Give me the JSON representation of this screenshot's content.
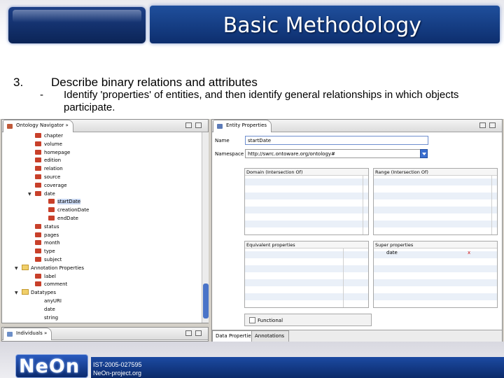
{
  "slide": {
    "title": "Basic Methodology",
    "bullet_number": "3.",
    "bullet_heading": "Describe binary relations and attributes",
    "sub_dash": "-",
    "sub_text": "Identify 'properties' of entities, and then identify general relationships in which objects participate."
  },
  "navigator": {
    "tab_label": "Ontology Navigator",
    "tab_suffix": "»",
    "tree": [
      {
        "label": "chapter",
        "icon": "property-icon",
        "indent": 1
      },
      {
        "label": "volume",
        "icon": "property-icon",
        "indent": 1
      },
      {
        "label": "homepage",
        "icon": "property-icon",
        "indent": 1
      },
      {
        "label": "edition",
        "icon": "property-icon",
        "indent": 1
      },
      {
        "label": "relation",
        "icon": "property-icon",
        "indent": 1
      },
      {
        "label": "source",
        "icon": "property-icon",
        "indent": 1
      },
      {
        "label": "coverage",
        "icon": "property-icon",
        "indent": 1
      },
      {
        "label": "date",
        "icon": "property-icon",
        "indent": 1,
        "twisty": "▼"
      },
      {
        "label": "startDate",
        "icon": "property-icon",
        "indent": 2,
        "selected": true
      },
      {
        "label": "creationDate",
        "icon": "property-icon",
        "indent": 2
      },
      {
        "label": "endDate",
        "icon": "property-icon",
        "indent": 2
      },
      {
        "label": "status",
        "icon": "property-icon",
        "indent": 1
      },
      {
        "label": "pages",
        "icon": "property-icon",
        "indent": 1
      },
      {
        "label": "month",
        "icon": "property-icon",
        "indent": 1
      },
      {
        "label": "type",
        "icon": "property-icon",
        "indent": 1
      },
      {
        "label": "subject",
        "icon": "property-icon",
        "indent": 1
      },
      {
        "label": "Annotation Properties",
        "icon": "folder-icon",
        "indent": 0,
        "twisty": "▼"
      },
      {
        "label": "label",
        "icon": "property-icon",
        "indent": 1
      },
      {
        "label": "comment",
        "icon": "property-icon",
        "indent": 1
      },
      {
        "label": "Datatypes",
        "icon": "folder-icon",
        "indent": 0,
        "twisty": "▼"
      },
      {
        "label": "anyURI",
        "icon": "none",
        "indent": 1
      },
      {
        "label": "date",
        "icon": "none",
        "indent": 1
      },
      {
        "label": "string",
        "icon": "none",
        "indent": 1
      }
    ]
  },
  "individuals": {
    "tab_label": "Individuals",
    "tab_suffix": "»"
  },
  "entity_properties": {
    "tab_label": "Entity Properties",
    "name_label": "Name",
    "name_value": "startDate",
    "namespace_label": "Namespace",
    "namespace_value": "http://swrc.ontoware.org/ontology#",
    "domain_header": "Domain (Intersection Of)",
    "range_header": "Range (Intersection Of)",
    "equivalent_header": "Equivalent properties",
    "super_header": "Super properties",
    "super_items": [
      {
        "label": "date",
        "remove": "x"
      }
    ],
    "functional_label": "Functional",
    "bottom_tabs": [
      "Data Properties",
      "Annotations"
    ]
  },
  "footer": {
    "project_id": "IST-2005-027595",
    "url": "NeOn-project.org",
    "logo_text": "NeOn"
  },
  "colors": {
    "title_band": "#1f4f9c",
    "selection": "#c9d8f2",
    "property_icon": "#c8402a"
  }
}
